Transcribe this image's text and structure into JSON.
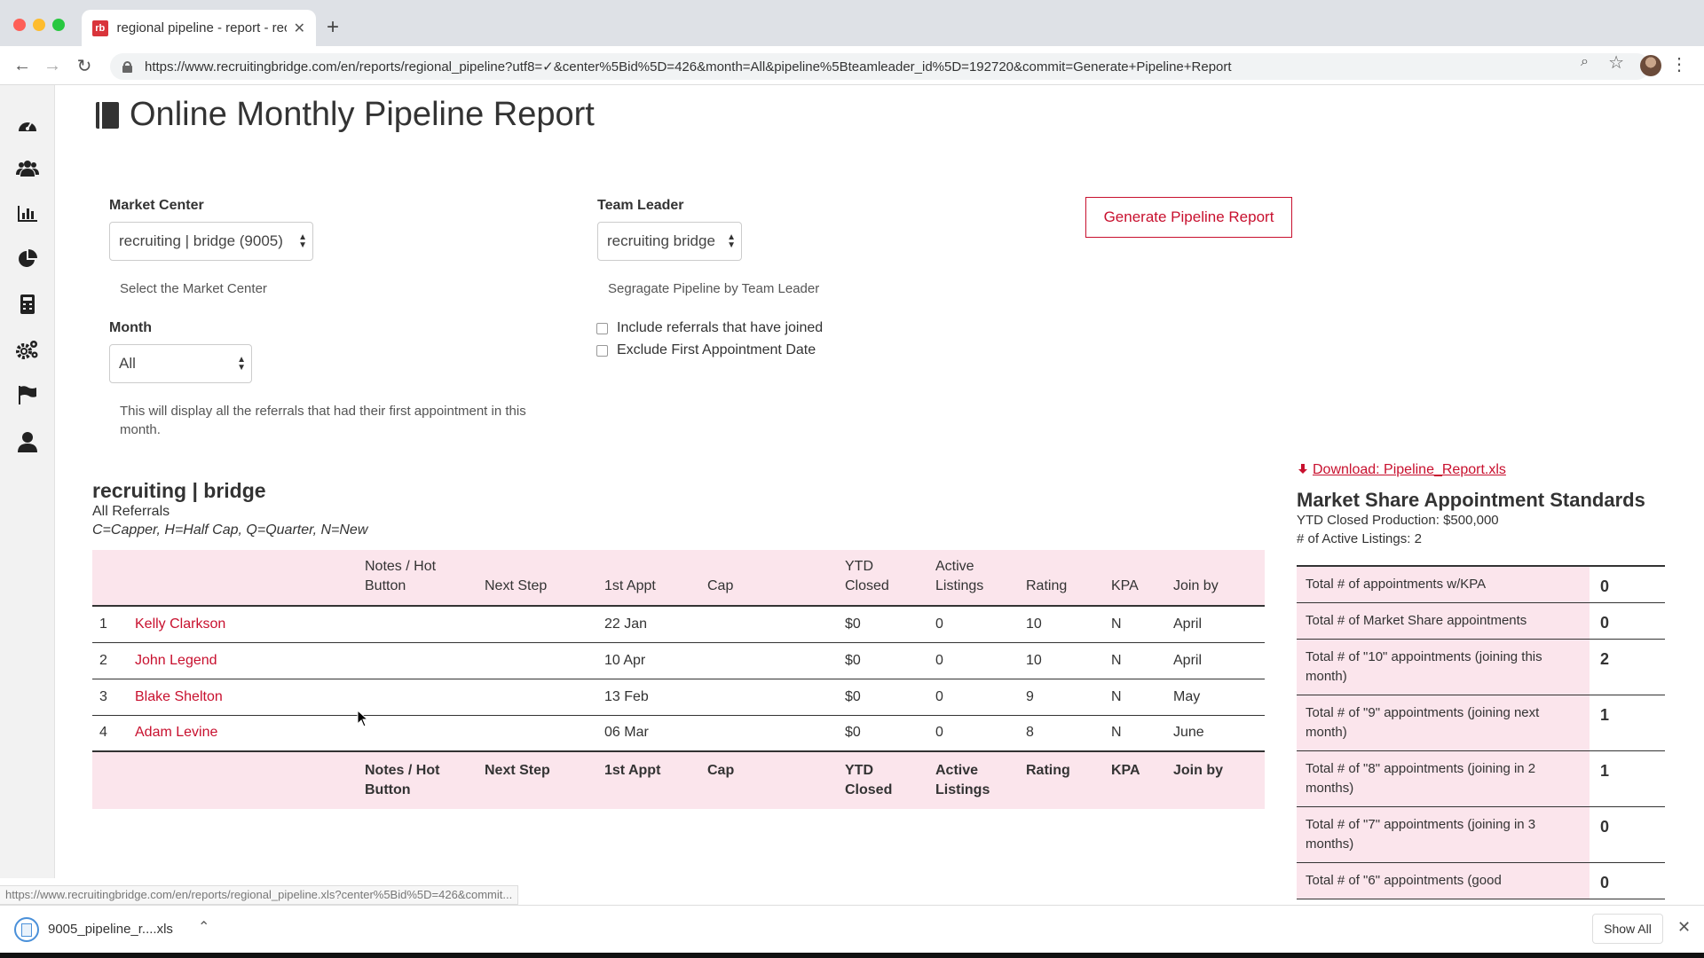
{
  "browser": {
    "tab_title": "regional pipeline - report - recr",
    "tab_favicon_text": "rb",
    "new_tab_symbol": "+",
    "tab_close_symbol": "✕",
    "url": "https://www.recruitingbridge.com/en/reports/regional_pipeline?utf8=✓&center%5Bid%5D=426&month=All&pipeline%5Bteamleader_id%5D=192720&commit=Generate+Pipeline+Report",
    "status_url": "https://www.recruitingbridge.com/en/reports/regional_pipeline.xls?center%5Bid%5D=426&commit..."
  },
  "page": {
    "title": "Online Monthly Pipeline Report"
  },
  "form": {
    "market_center_label": "Market Center",
    "market_center_value": "recruiting | bridge (9005)",
    "market_center_help": "Select the Market Center",
    "team_leader_label": "Team Leader",
    "team_leader_value": "recruiting bridge",
    "team_leader_help": "Segragate Pipeline by Team Leader",
    "month_label": "Month",
    "month_value": "All",
    "month_help": "This will display all the referrals that had their first appointment in this month.",
    "include_referrals_label": "Include referrals that have joined",
    "exclude_first_appt_label": "Exclude First Appointment Date",
    "generate_button": "Generate Pipeline Report"
  },
  "report": {
    "heading": "recruiting | bridge",
    "subheading": "All Referrals",
    "legend": "C=Capper, H=Half Cap, Q=Quarter, N=New",
    "columns": {
      "num": "",
      "name": "",
      "notes": "Notes / Hot Button",
      "next_step": "Next Step",
      "first_appt": "1st Appt",
      "cap": "Cap",
      "ytd_closed": "YTD Closed",
      "active_listings": "Active Listings",
      "rating": "Rating",
      "kpa": "KPA",
      "join_by": "Join by"
    },
    "rows": [
      {
        "num": "1",
        "name": "Kelly Clarkson",
        "notes": "",
        "next_step": "",
        "first_appt": "22 Jan",
        "cap": "",
        "ytd_closed": "$0",
        "active_listings": "0",
        "rating": "10",
        "kpa": "N",
        "join_by": "April"
      },
      {
        "num": "2",
        "name": "John Legend",
        "notes": "",
        "next_step": "",
        "first_appt": "10 Apr",
        "cap": "",
        "ytd_closed": "$0",
        "active_listings": "0",
        "rating": "10",
        "kpa": "N",
        "join_by": "April"
      },
      {
        "num": "3",
        "name": "Blake Shelton",
        "notes": "",
        "next_step": "",
        "first_appt": "13 Feb",
        "cap": "",
        "ytd_closed": "$0",
        "active_listings": "0",
        "rating": "9",
        "kpa": "N",
        "join_by": "May"
      },
      {
        "num": "4",
        "name": "Adam Levine",
        "notes": "",
        "next_step": "",
        "first_appt": "06 Mar",
        "cap": "",
        "ytd_closed": "$0",
        "active_listings": "0",
        "rating": "8",
        "kpa": "N",
        "join_by": "June"
      }
    ]
  },
  "standards": {
    "download_link": "Download: Pipeline_Report.xls",
    "heading": "Market Share Appointment Standards",
    "ytd_closed": "YTD Closed Production: $500,000",
    "active_listings": "# of Active Listings: 2",
    "rows": [
      {
        "label": "Total # of appointments w/KPA",
        "value": "0"
      },
      {
        "label": "Total # of Market Share appointments",
        "value": "0"
      },
      {
        "label": "Total # of \"10\" appointments (joining this month)",
        "value": "2"
      },
      {
        "label": "Total # of \"9\" appointments (joining next month)",
        "value": "1"
      },
      {
        "label": "Total # of \"8\" appointments (joining in 2 months)",
        "value": "1"
      },
      {
        "label": "Total # of \"7\" appointments (joining in 3 months)",
        "value": "0"
      },
      {
        "label": "Total # of \"6\" appointments (good",
        "value": "0"
      }
    ]
  },
  "downloads": {
    "file_name": "9005_pipeline_r....xls",
    "show_all": "Show All"
  },
  "colors": {
    "accent": "#c8102e",
    "table_header_bg": "#fbe5ec"
  },
  "icons": {
    "sidebar": [
      "dashboard-icon",
      "users-icon",
      "bar-chart-icon",
      "pie-chart-icon",
      "calculator-icon",
      "gears-icon",
      "flag-icon",
      "user-icon"
    ]
  }
}
